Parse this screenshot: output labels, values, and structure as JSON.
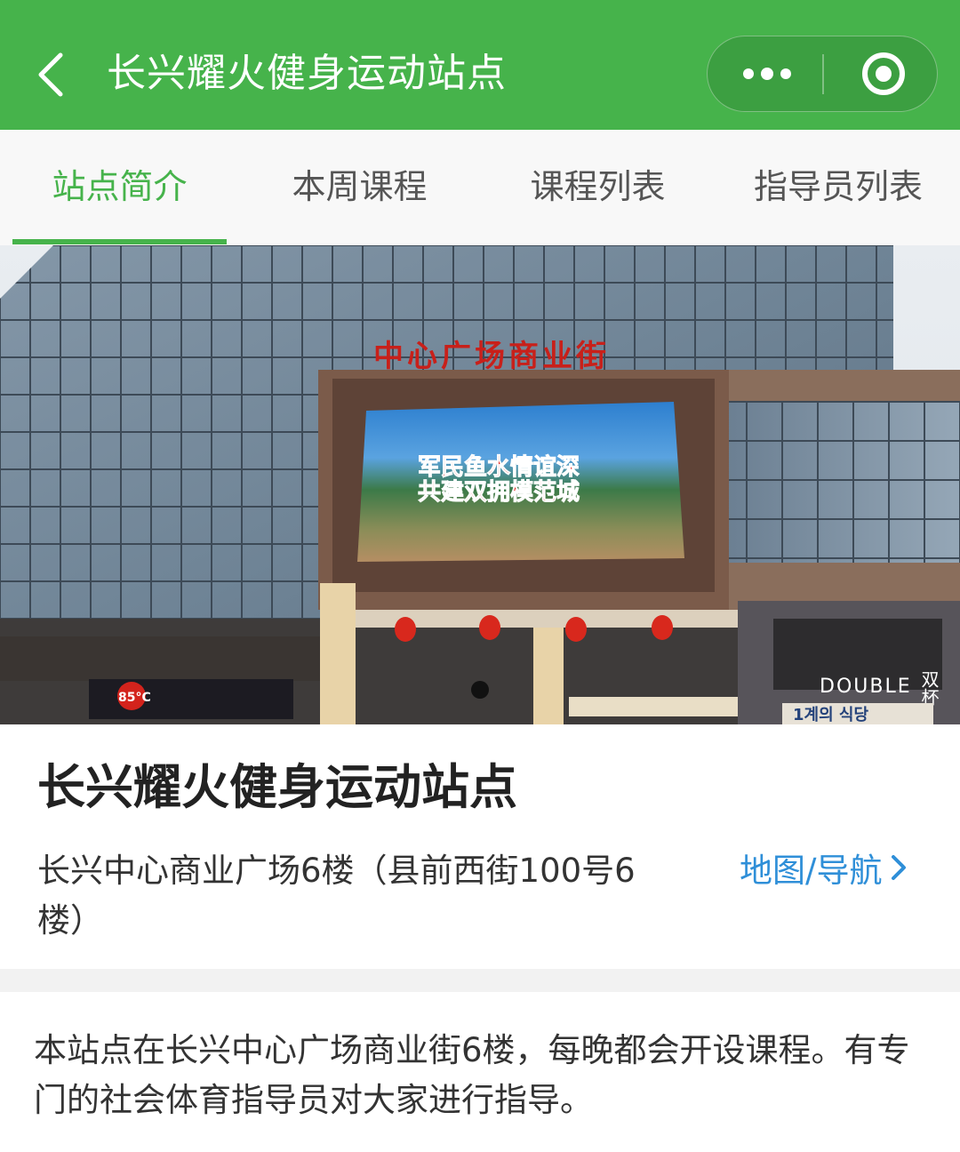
{
  "header": {
    "title": "长兴耀火健身运动站点",
    "back_icon": "chevron-left-icon",
    "more_icon": "more-dots-icon",
    "close_icon": "target-circle-icon",
    "bar_color": "#46b34b"
  },
  "tabs": [
    {
      "label": "站点简介",
      "active": true
    },
    {
      "label": "本周课程",
      "active": false
    },
    {
      "label": "课程列表",
      "active": false
    },
    {
      "label": "指导员列表",
      "active": false
    }
  ],
  "hero": {
    "building_sign": "中心广场商业街",
    "screen_text_line1": "军民鱼水情谊深",
    "screen_text_line2": "共建双拥模范城",
    "shop_sign_left": "85°C",
    "shop_sign_right": "DOUBLE",
    "shop_sign_right_cn": "双杯",
    "korean_sign": "1계의 식당"
  },
  "station": {
    "name": "长兴耀火健身运动站点",
    "address": "长兴中心商业广场6楼（县前西街100号6楼）",
    "map_link": "地图/导航",
    "map_link_color": "#2f8fd8"
  },
  "description": "本站点在长兴中心广场商业街6楼，每晚都会开设课程。有专门的社会体育指导员对大家进行指导。"
}
